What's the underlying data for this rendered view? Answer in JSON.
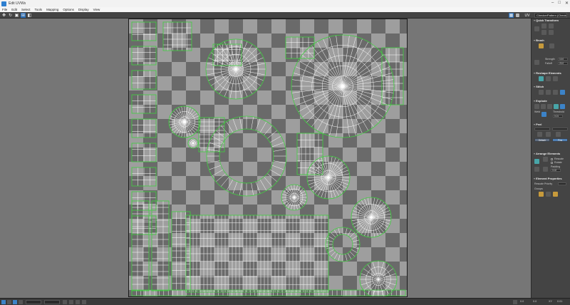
{
  "window": {
    "title": "Edit UVWs"
  },
  "menu": [
    "File",
    "Edit",
    "Select",
    "Tools",
    "Mapping",
    "Options",
    "Display",
    "View"
  ],
  "toolbar": {
    "map_dropdown": "CheckerPattern (Checker)"
  },
  "panel": {
    "quick_transform": "Quick Transform",
    "reshape": "Reshape Elements",
    "stitch": "Stitch",
    "explode": "Explode",
    "peel": "Peel",
    "arrange": "Arrange Elements",
    "props": "Element Properties",
    "brush": "Brush",
    "strength_label": "Strength",
    "strength_value": "10.0",
    "falloff_label": "Falloff",
    "falloff_value": "20.0",
    "threshold_label": "Threshold",
    "threshold_value": "0.01",
    "weld_label": "Weld",
    "rescale_label": "Rescale",
    "rotate_label": "Rotate",
    "padding_label": "Padding",
    "padding_value": "0.02",
    "rescale_priority_label": "Rescale Priority",
    "groups_label": "Groups",
    "peel_btn_1": "Detach",
    "peel_btn_2": "Pins"
  },
  "status": {
    "u_value": "0.0",
    "v_value": "0.0",
    "zoom_label": "XY",
    "zoom_value": "0.01"
  }
}
